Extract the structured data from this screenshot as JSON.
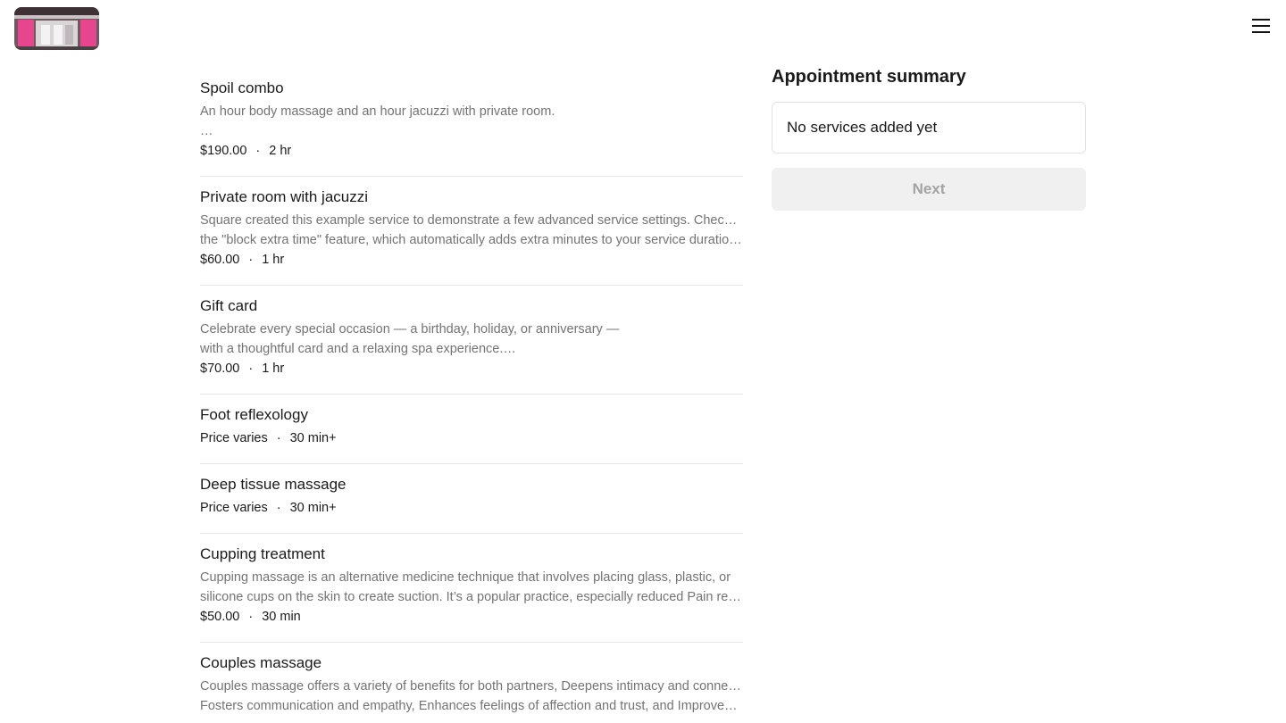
{
  "header": {
    "logo_alt": "Spa storefront",
    "menu_icon": "hamburger-menu-icon"
  },
  "services": [
    {
      "name": "Spoil combo",
      "desc_lines": [
        "An hour body massage and an hour jacuzzi with private room.",
        "…"
      ],
      "price": "$190.00",
      "duration": "2 hr"
    },
    {
      "name": "Private room with jacuzzi",
      "desc_lines": [
        "Square created this example service to demonstrate a few advanced service settings. Check out",
        "the \"block extra time\" feature, which automatically adds extra minutes to your service duration,…"
      ],
      "price": "$60.00",
      "duration": "1 hr"
    },
    {
      "name": "Gift card",
      "desc_lines": [
        "Celebrate every special occasion — a birthday, holiday, or anniversary —",
        "with a thoughtful card and a relaxing spa experience.…"
      ],
      "price": "$70.00",
      "duration": "1 hr"
    },
    {
      "name": "Foot reflexology",
      "desc_lines": [],
      "price": "Price varies",
      "duration": "30 min+"
    },
    {
      "name": "Deep tissue massage",
      "desc_lines": [],
      "price": "Price varies",
      "duration": "30 min+"
    },
    {
      "name": "Cupping treatment",
      "desc_lines": [
        "Cupping massage is an alternative medicine technique that involves placing glass, plastic, or",
        "silicone cups on the skin to create suction. It’s a popular practice, especially reduced Pain relief,…"
      ],
      "price": "$50.00",
      "duration": "30 min"
    },
    {
      "name": "Couples massage",
      "desc_lines": [
        "Couples massage offers a variety of benefits for both partners, Deepens intimacy and connection,",
        "Fosters communication and empathy, Enhances feelings of affection and trust, and Improves…"
      ],
      "price": "",
      "duration": ""
    }
  ],
  "summary": {
    "title": "Appointment summary",
    "empty_text": "No services added yet",
    "next_label": "Next"
  }
}
